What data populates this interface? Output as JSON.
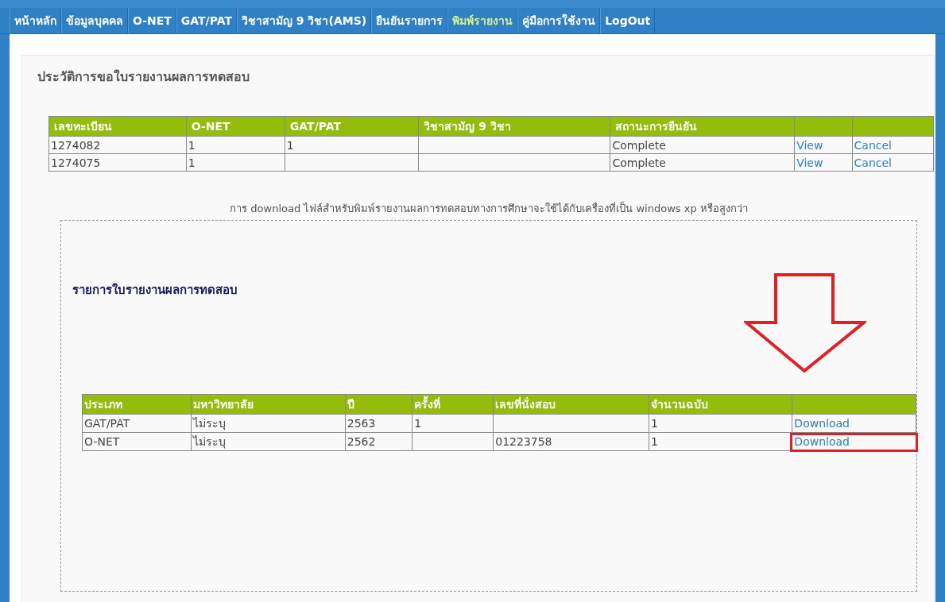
{
  "nav": [
    {
      "label": "หน้าหลัก",
      "selected": false
    },
    {
      "label": "ข้อมูลบุคคล",
      "selected": false
    },
    {
      "label": "O-NET",
      "selected": false
    },
    {
      "label": "GAT/PAT",
      "selected": false
    },
    {
      "label": "วิชาสามัญ 9 วิชา(AMS)",
      "selected": false
    },
    {
      "label": "ยืนยันรายการ",
      "selected": false
    },
    {
      "label": "พิมพ์รายงาน",
      "selected": true
    },
    {
      "label": "คู่มือการใช้งาน",
      "selected": false
    },
    {
      "label": "LogOut",
      "selected": false
    }
  ],
  "history": {
    "title": "ประวัติการขอใบรายงานผลการทดสอบ",
    "columns": [
      "เลขทะเบียน",
      "O-NET",
      "GAT/PAT",
      "วิชาสามัญ 9 วิชา",
      "สถานะการยืนยัน"
    ],
    "rows": [
      {
        "cells": [
          "1274082",
          "1",
          "1",
          "",
          "Complete"
        ],
        "view": "View",
        "cancel": "Cancel"
      },
      {
        "cells": [
          "1274075",
          "1",
          "",
          "",
          "Complete"
        ],
        "view": "View",
        "cancel": "Cancel"
      }
    ]
  },
  "note": "การ download ไฟล์สำหรับพิมพ์รายงานผลการทดสอบทางการศึกษาจะใช้ได้กับเครื่องที่เป็น windows xp หรือสูงกว่า",
  "reports": {
    "title": "รายการใบรายงานผลการทดสอบ",
    "columns": [
      "ประเภท",
      "มหาวิทยาลัย",
      "ปี",
      "ครั้งที่",
      "เลขที่นั่งสอบ",
      "จำนวนฉบับ"
    ],
    "rows": [
      {
        "cells": [
          "GAT/PAT",
          "ไม่ระบุ",
          "2563",
          "1",
          "",
          "1"
        ],
        "download": "Download",
        "highlighted": false
      },
      {
        "cells": [
          "O-NET",
          "ไม่ระบุ",
          "2562",
          "",
          "01223758",
          "1"
        ],
        "download": "Download",
        "highlighted": true
      }
    ]
  }
}
